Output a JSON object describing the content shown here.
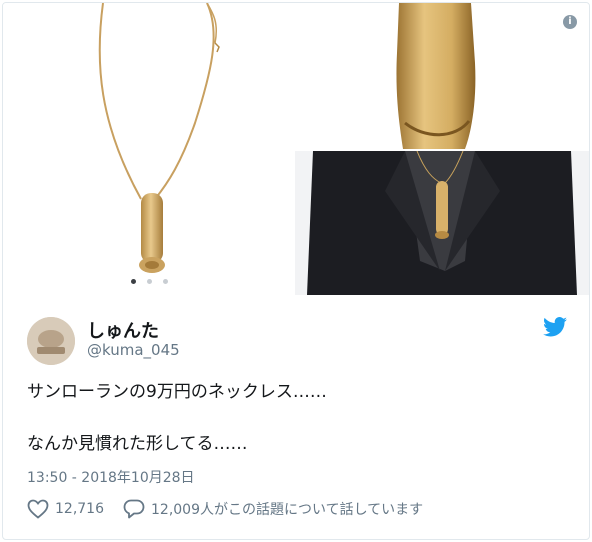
{
  "media": {
    "info_icon": "info-icon",
    "carousel_active_index": 1,
    "carousel_count": 3
  },
  "author": {
    "name": "しゅんた",
    "handle": "@kuma_045"
  },
  "tweet": {
    "line1": "サンローランの9万円のネックレス……",
    "line2": "なんか見慣れた形してる……",
    "timestamp": "13:50 - 2018年10月28日"
  },
  "actions": {
    "likes": "12,716",
    "conversation": "12,009人がこの話題について話しています"
  },
  "colors": {
    "twitter_blue": "#1da1f2",
    "muted_text": "#657786",
    "gold": "#c9a35c"
  }
}
